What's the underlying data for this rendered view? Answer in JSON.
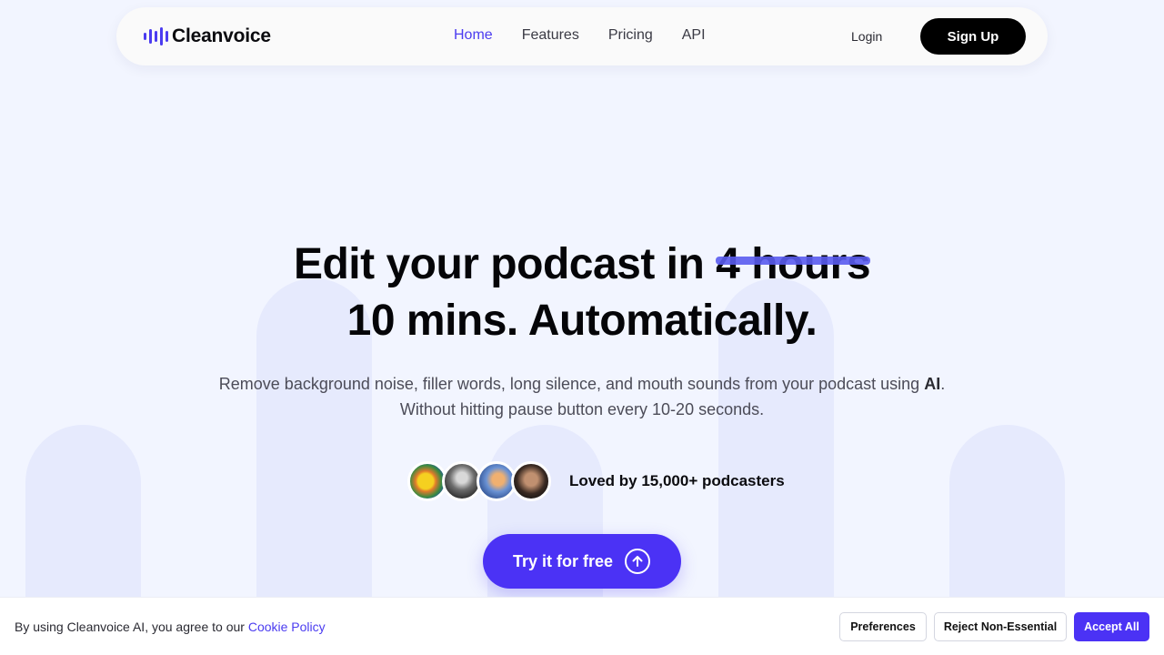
{
  "brand": {
    "name": "Cleanvoice",
    "accent": "#4b32f5"
  },
  "nav": {
    "links": [
      {
        "label": "Home",
        "active": true
      },
      {
        "label": "Features",
        "active": false
      },
      {
        "label": "Pricing",
        "active": false
      },
      {
        "label": "API",
        "active": false
      }
    ],
    "login_label": "Login",
    "signup_label": "Sign Up"
  },
  "hero": {
    "headline_before": "Edit your podcast in ",
    "headline_struck": "4 hours",
    "headline_line2": "10 mins. Automatically.",
    "sub_line1_before": "Remove background noise, filler words, long silence, and mouth sounds from your podcast using ",
    "sub_line1_bold": "AI",
    "sub_line1_after": ".",
    "sub_line2": "Without hitting pause button every 10-20 seconds.",
    "social_proof": "Loved by 15,000+ podcasters",
    "cta_label": "Try it for free",
    "cta_icon": "arrow-up-circle-icon"
  },
  "cookie": {
    "text": "By using Cleanvoice AI, you agree to our ",
    "link": "Cookie Policy",
    "preferences": "Preferences",
    "reject": "Reject Non-Essential",
    "accept": "Accept All"
  }
}
